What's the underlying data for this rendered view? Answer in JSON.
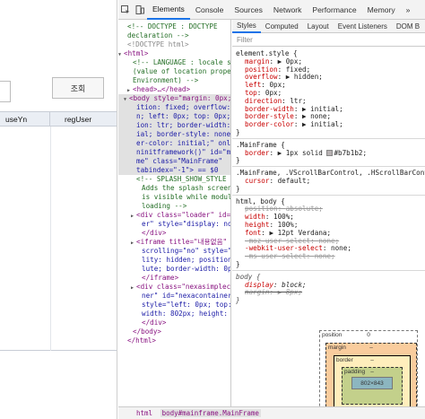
{
  "app": {
    "query_button": "조회",
    "grid_columns": [
      "useYn",
      "regUser"
    ]
  },
  "devtools": {
    "icons": [
      "inspect-icon",
      "device-toolbar-icon"
    ],
    "tabs": [
      "Elements",
      "Console",
      "Sources",
      "Network",
      "Performance",
      "Memory"
    ],
    "active_tab": "Elements",
    "more_tabs_glyph": "»",
    "elements": {
      "lines": [
        {
          "t": "<!-- DOCTYPE : DOCTYPE",
          "k": "cm",
          "x": 10
        },
        {
          "t": "declaration -->",
          "k": "cm",
          "x": 10
        },
        {
          "t": "<!DOCTYPE html>",
          "k": "gry",
          "x": 10
        },
        {
          "t": "<html>",
          "k": "tg",
          "x": 6,
          "arrow": "▼"
        },
        {
          "t": "<!-- LANGUAGE : locale set",
          "k": "cm",
          "x": 16
        },
        {
          "t": "(value of location proper",
          "k": "cm",
          "x": 16
        },
        {
          "t": "Environment) -->",
          "k": "cm",
          "x": 16
        },
        {
          "t": "<head>…</head>",
          "k": "tg",
          "x": 16,
          "arrow": "▶"
        },
        {
          "t": "<body style=\"margin: 0px;",
          "k": "tg",
          "x": 12,
          "arrow": "▼",
          "sel": true
        },
        {
          "t": "ition: fixed; overflow: h",
          "k": "av",
          "x": 20,
          "sel": true
        },
        {
          "t": "n; left: 0px; top: 0px; d",
          "k": "av",
          "x": 20,
          "sel": true
        },
        {
          "t": "ion: ltr; border-width: i",
          "k": "av",
          "x": 20,
          "sel": true
        },
        {
          "t": "ial; border-style: none;",
          "k": "av",
          "x": 20,
          "sel": true
        },
        {
          "t": "er-color: initial;\" onloa",
          "k": "av",
          "x": 20,
          "sel": true
        },
        {
          "t": "ninitframework()\" id=\"mai",
          "k": "av",
          "x": 20,
          "sel": true
        },
        {
          "t": "me\" class=\"MainFrame\"",
          "k": "av",
          "x": 20,
          "sel": true
        },
        {
          "t": "tabindex=\"-1\"> == $0",
          "k": "av",
          "x": 20,
          "sel": true
        },
        {
          "t": "<!-- SPLASH_SHOW_STYLE",
          "k": "cm",
          "x": 20
        },
        {
          "t": "Adds the splash screen",
          "k": "cm",
          "x": 26
        },
        {
          "t": "is visible while modules",
          "k": "cm",
          "x": 26
        },
        {
          "t": "loading -->",
          "k": "cm",
          "x": 26
        },
        {
          "t": "<div class=\"loader\" id=",
          "k": "tg",
          "x": 20,
          "arrow": "▶"
        },
        {
          "t": "er\" style=\"display: none",
          "k": "av",
          "x": 26
        },
        {
          "t": "</div>",
          "k": "tg",
          "x": 26
        },
        {
          "t": "<iframe title=\"내용없음\"",
          "k": "tg",
          "x": 20,
          "arrow": "▶"
        },
        {
          "t": "scrolling=\"no\" style=\"vis",
          "k": "av",
          "x": 26
        },
        {
          "t": "lity: hidden; position:",
          "k": "av",
          "x": 26
        },
        {
          "t": "lute; border-width: 0px;",
          "k": "av",
          "x": 26
        },
        {
          "t": "</iframe>",
          "k": "tg",
          "x": 26
        },
        {
          "t": "<div class=\"nexasimplecc",
          "k": "tg",
          "x": 20,
          "arrow": "▶"
        },
        {
          "t": "ner\" id=\"nexacontainer\"",
          "k": "av",
          "x": 26
        },
        {
          "t": "style=\"left: 0px; top: 0",
          "k": "av",
          "x": 26
        },
        {
          "t": "width: 802px; height: 84",
          "k": "av",
          "x": 26
        },
        {
          "t": "</div>",
          "k": "tg",
          "x": 26
        },
        {
          "t": "</body>",
          "k": "tg",
          "x": 16
        },
        {
          "t": "</html>",
          "k": "tg",
          "x": 10
        }
      ]
    },
    "breadcrumb": {
      "html": "html",
      "body": "body#mainframe.MainFrame"
    },
    "styles": {
      "subtabs": [
        "Styles",
        "Computed",
        "Layout",
        "Event Listeners",
        "DOM B"
      ],
      "active_subtab": "Styles",
      "filter_placeholder": "Filter",
      "element_style_selector": "element.style {",
      "element_style": [
        {
          "n": "margin",
          "v": "▶ 0px;"
        },
        {
          "n": "position",
          "v": "fixed;"
        },
        {
          "n": "overflow",
          "v": "▶ hidden;"
        },
        {
          "n": "left",
          "v": "0px;"
        },
        {
          "n": "top",
          "v": "0px;"
        },
        {
          "n": "direction",
          "v": "ltr;"
        },
        {
          "n": "border-width",
          "v": "▶ initial;"
        },
        {
          "n": "border-style",
          "v": "▶ none;"
        },
        {
          "n": "border-color",
          "v": "▶ initial;"
        }
      ],
      "close_brace": "}",
      "mainframe_selector": ".MainFrame {",
      "mainframe_border_name": "border",
      "mainframe_border_value": "▶ 1px solid",
      "mainframe_border_color": "#b7b1b2;",
      "scroll_selector": ".MainFrame, .VScrollBarControl, .HScrollBarContr",
      "scroll_cursor_name": "cursor",
      "scroll_cursor_value": "default;",
      "htmlbody_selector": "html, body {",
      "htmlbody_rules": [
        {
          "n": "position",
          "v": "absolute;",
          "strike": true
        },
        {
          "n": "width",
          "v": "100%;"
        },
        {
          "n": "height",
          "v": "100%;"
        },
        {
          "n": "font",
          "v": "▶ 12pt Verdana;"
        },
        {
          "n": "-moz-user-select",
          "v": "none;",
          "strike": true
        },
        {
          "n": "-webkit-user-select",
          "v": "none;"
        },
        {
          "n": "-ms-user-select",
          "v": "none;",
          "strike": true
        }
      ],
      "body_selector": "body {",
      "body_rules": [
        {
          "n": "display",
          "v": "block;"
        },
        {
          "n": "margin",
          "v": "▶ 8px;",
          "strike": true
        }
      ]
    },
    "boxmodel": {
      "position_label": "position",
      "position_value": "0",
      "margin_label": "margin",
      "margin_value": "–",
      "border_label": "border",
      "border_value": "–",
      "padding_label": "padding",
      "padding_value": "–",
      "content": "802×843"
    }
  }
}
